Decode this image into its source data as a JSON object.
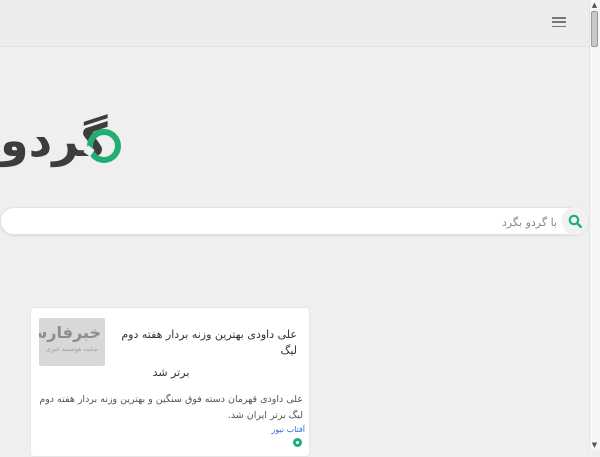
{
  "header": {
    "menu_icon": "hamburger-menu-icon"
  },
  "logo": {
    "text": "گردو",
    "colors": {
      "text": "#3d3d3d",
      "ring": "#1fae74"
    }
  },
  "search": {
    "placeholder": "با گردو بگرد",
    "value": "",
    "icon": "search-icon",
    "icon_color": "#1fae74"
  },
  "news": {
    "items": [
      {
        "thumbnail_text": "خبرفارسی",
        "thumbnail_subtext": "سایت هوشمند خبری",
        "title_line1": "علی داودی بهترین وزنه بردار هفته دوم لیگ",
        "title_line2": "برتر شد",
        "description": "علی داودی قهرمان دسته فوق سنگین و بهترین وزنه بردار هفته دوم لیگ برتر ایران شد.",
        "source": "آفتاب نیوز",
        "source_icon": "gerdoo-source-icon"
      }
    ]
  }
}
